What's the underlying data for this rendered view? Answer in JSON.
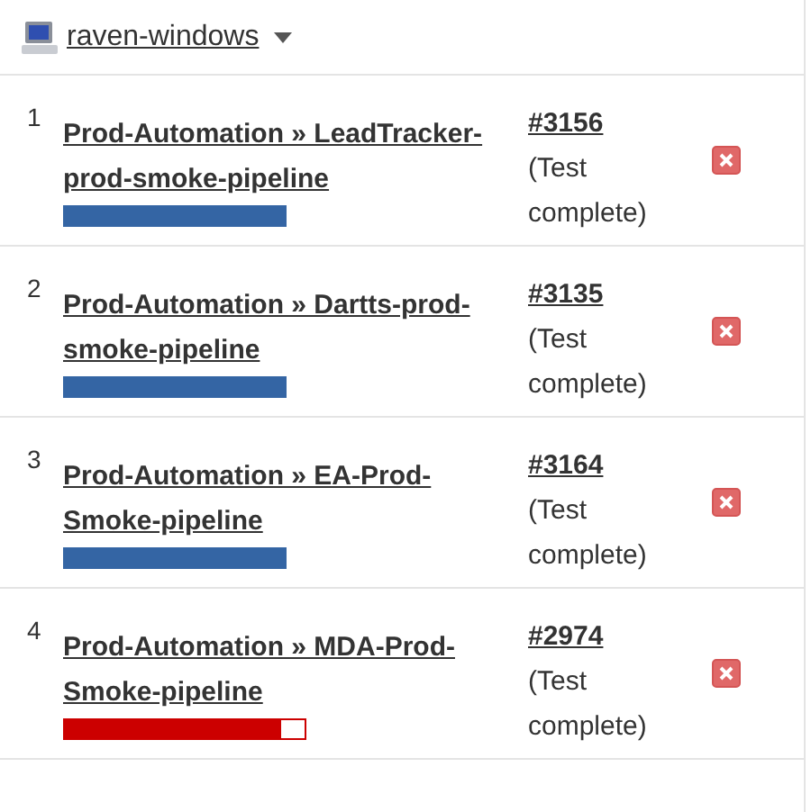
{
  "node": {
    "name": "raven-windows"
  },
  "builds": [
    {
      "index": "1",
      "job": "Prod-Automation » LeadTracker-prod-smoke-pipeline",
      "progress": {
        "kind": "normal",
        "color": "#3465a4",
        "level": 0.92
      },
      "number": "#3156",
      "status": "(Test complete)"
    },
    {
      "index": "2",
      "job": "Prod-Automation » Dartts-prod-smoke-pipeline",
      "progress": {
        "kind": "normal",
        "color": "#3465a4",
        "level": 0.92
      },
      "number": "#3135",
      "status": "(Test complete)"
    },
    {
      "index": "3",
      "job": "Prod-Automation » EA-Prod-Smoke-pipeline",
      "progress": {
        "kind": "normal",
        "color": "#3465a4",
        "level": 0.92
      },
      "number": "#3164",
      "status": "(Test complete)"
    },
    {
      "index": "4",
      "job": "Prod-Automation » MDA-Prod-Smoke-pipeline",
      "progress": {
        "kind": "overtime",
        "color": "#cc0000",
        "level": 0.9
      },
      "number": "#2974",
      "status": "(Test complete)"
    }
  ]
}
